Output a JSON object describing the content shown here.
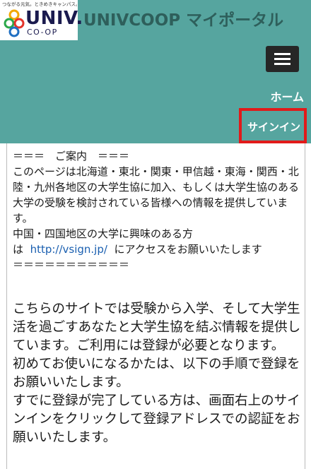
{
  "header": {
    "logo": {
      "tagline": "つながる元気。ときめきキャンパス。",
      "wordmark": "UNIV.",
      "subtext": "CO-OP"
    },
    "site_title": "UNIVCOOP マイポータル",
    "menu_icon": "hamburger-icon",
    "nav": {
      "home": "ホーム",
      "signin": "サインイン"
    },
    "colors": {
      "header_bg": "#56a59f",
      "highlight_border": "#e11a1a",
      "menu_button_bg": "#262626",
      "link": "#1a5fb0"
    }
  },
  "notice": {
    "heading": "＝＝＝　ご案内　＝＝＝",
    "body": "このページは北海道・東北・関東・甲信越・東海・関西・北陸・九州各地区の大学生協に加入、もしくは大学生協のある大学の受験を検討されている皆様への情報を提供しています。",
    "chugoku": "中国・四国地区の大学に興味のある方",
    "link_prefix": "は",
    "link_text": "http://vsign.jp/",
    "link_suffix": "にアクセスをお願いいたします",
    "divider": "＝＝＝＝＝＝＝＝＝＝＝"
  },
  "intro": {
    "para1": "こちらのサイトでは受験から入学、そして大学生活を過ごすあなたと大学生協を結ぶ情報を提供しています。ご利用には登録が必要となります。",
    "para2": "初めてお使いになるかたは、以下の手順で登録をお願いいたします。",
    "para3": "すでに登録が完了している方は、画面右上のサインインをクリックして登録アドレスでの認証をお願いいたします。"
  }
}
